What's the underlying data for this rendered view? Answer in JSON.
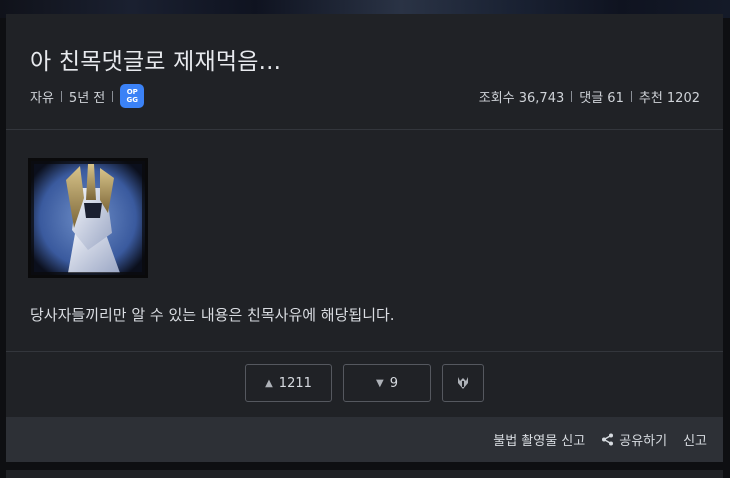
{
  "post": {
    "title": "아 친목댓글로 제재먹음...",
    "category": "자유",
    "time_ago": "5년 전",
    "badge_text": "OP GG",
    "body": "당사자들끼리만 알 수 있는 내용은 친목사유에 해당됩니다."
  },
  "stats": {
    "views": "조회수 36,743",
    "comments": "댓글 61",
    "recommend": "추천 1202"
  },
  "votes": {
    "up": "1211",
    "down": "9"
  },
  "footer": {
    "report_illegal": "불법 촬영물 신고",
    "share": "공유하기",
    "report": "신고"
  },
  "icons": {
    "upvote": "triangle-up-icon",
    "downvote": "triangle-down-icon",
    "award": "crest-icon",
    "share": "share-icon"
  },
  "colors": {
    "card_bg": "#202226",
    "page_bg": "#0e0f12",
    "footer_bg": "#2d3036",
    "badge_blue": "#3b82f6"
  }
}
